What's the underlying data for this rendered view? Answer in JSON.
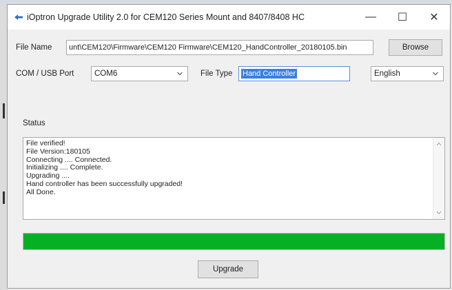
{
  "window": {
    "title": "iOptron Upgrade Utility 2.0 for CEM120 Series Mount and 8407/8408 HC",
    "minimize": "—",
    "maximize": "☐",
    "close": "✕"
  },
  "file": {
    "label": "File Name",
    "value": "unt\\CEM120\\Firmware\\CEM120 Firmware\\CEM120_HandController_20180105.bin",
    "browse": "Browse"
  },
  "port": {
    "label": "COM / USB Port",
    "selected": "COM6"
  },
  "file_type": {
    "label": "File Type",
    "value": "Hand Controller"
  },
  "language": {
    "selected": "English"
  },
  "status": {
    "label": "Status",
    "lines": [
      "File verified!",
      "File Version:180105",
      "Connecting .... Connected.",
      "Initializing .... Complete.",
      "Upgrading ....",
      "Hand controller has been successfully upgraded!",
      "All Done."
    ]
  },
  "progress": {
    "percent": 100,
    "color": "#06b025"
  },
  "upgrade_button": "Upgrade",
  "icons": [
    "app-arrow-icon",
    "chevron-down-icon",
    "scroll-up-icon",
    "scroll-down-icon"
  ]
}
